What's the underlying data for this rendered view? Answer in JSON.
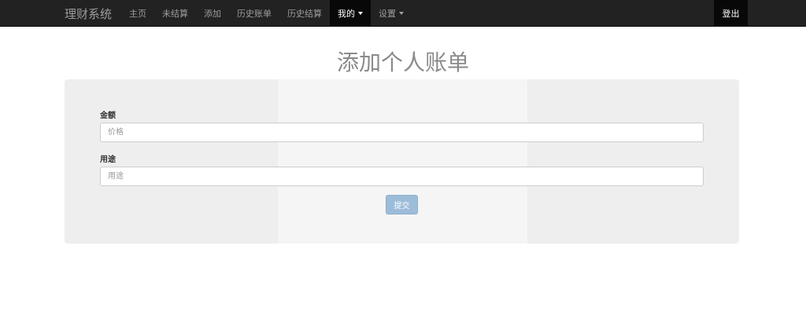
{
  "navbar": {
    "brand": "理财系统",
    "items": [
      {
        "label": "主页",
        "active": false
      },
      {
        "label": "未结算",
        "active": false
      },
      {
        "label": "添加",
        "active": false
      },
      {
        "label": "历史账单",
        "active": false
      },
      {
        "label": "历史结算",
        "active": false
      },
      {
        "label": "我的",
        "active": true,
        "dropdown": true
      },
      {
        "label": "设置",
        "active": false,
        "dropdown": true
      }
    ],
    "logout": "登出"
  },
  "page": {
    "title": "添加个人账单"
  },
  "form": {
    "amount_label": "金额",
    "amount_placeholder": "价格",
    "amount_value": "",
    "purpose_label": "用途",
    "purpose_placeholder": "用途",
    "purpose_value": "",
    "submit_label": "提交"
  },
  "colors": {
    "navbar_bg": "#222222",
    "active_bg": "#080808",
    "panel_bg": "#eeeeee",
    "submit_bg": "#9dbcd9"
  }
}
